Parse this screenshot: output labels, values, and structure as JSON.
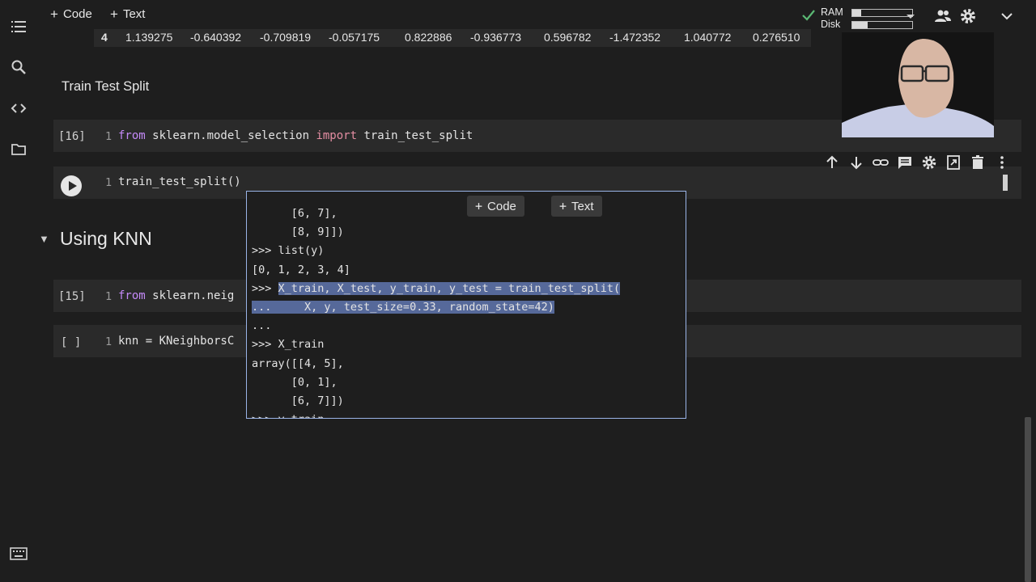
{
  "toolbar": {
    "code_label": "Code",
    "text_label": "Text",
    "ram_label": "RAM",
    "disk_label": "Disk",
    "ram_fraction": 0.15,
    "disk_fraction": 0.25
  },
  "data_row": {
    "index": "4",
    "values": [
      "1.139275",
      "-0.640392",
      "-0.709819",
      "-0.057175",
      "0.822886",
      "-0.936773",
      "0.596782",
      "-1.472352",
      "1.040772",
      "0.276510"
    ]
  },
  "markdown": {
    "train_test_split_title": "Train Test Split",
    "section_title": "Using KNN"
  },
  "cells": [
    {
      "prompt": "[16]",
      "line": "1",
      "tokens": [
        [
          "from",
          "kw"
        ],
        [
          " sklearn.model_selection ",
          ""
        ],
        [
          "import",
          "kw2"
        ],
        [
          " train_test_split",
          ""
        ]
      ]
    },
    {
      "prompt": "",
      "line": "1",
      "tokens": [
        [
          "train_test_split()",
          ""
        ]
      ]
    },
    {
      "prompt": "[15]",
      "line": "1",
      "tokens": [
        [
          "from",
          "kw"
        ],
        [
          " sklearn.neig",
          ""
        ]
      ]
    },
    {
      "prompt": "[ ]",
      "line": "1",
      "tokens": [
        [
          "knn = KNeighborsC",
          ""
        ]
      ]
    }
  ],
  "popup": {
    "code_label": "Code",
    "text_label": "Text",
    "lines": [
      {
        "text": "      [6, 7],",
        "hl": ""
      },
      {
        "text": "      [8, 9]])",
        "hl": ""
      },
      {
        "text": ">>> list(y)",
        "hl": ""
      },
      {
        "text": "[0, 1, 2, 3, 4]",
        "hl": ""
      },
      {
        "text": ">>> X_train, X_test, y_train, y_test = train_test_split(",
        "hl": "from4"
      },
      {
        "text": "...     X, y, test_size=0.33, random_state=42)",
        "hl": "all"
      },
      {
        "text": "...",
        "hl": ""
      },
      {
        "text": ">>> X_train",
        "hl": ""
      },
      {
        "text": "array([[4, 5],",
        "hl": ""
      },
      {
        "text": "      [0, 1],",
        "hl": ""
      },
      {
        "text": "      [6, 7]])",
        "hl": ""
      },
      {
        "text": ">>> y_train",
        "hl": ""
      }
    ]
  },
  "colors": {
    "background": "#1e1e1e",
    "cell": "#2a2a2a",
    "keyword": "#c58af9",
    "import_keyword": "#e58ea3",
    "selection": "#56699a",
    "popup_border": "#9ab4e8",
    "status_ok": "#5bb974"
  }
}
